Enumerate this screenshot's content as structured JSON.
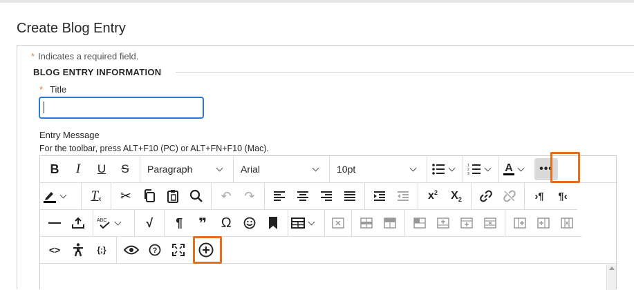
{
  "page": {
    "title": "Create Blog Entry",
    "required_note": "Indicates a required field.",
    "required_marker": "*"
  },
  "section": {
    "title": "BLOG ENTRY INFORMATION"
  },
  "title_field": {
    "label": "Title",
    "value": ""
  },
  "entry_message": {
    "label": "Entry Message",
    "toolbar_hint": "For the toolbar, press ALT+F10 (PC) or ALT+FN+F10 (Mac)."
  },
  "toolbar": {
    "bold": "B",
    "italic": "I",
    "underline": "U",
    "strikethrough": "S",
    "paragraph_format": "Paragraph",
    "font_family": "Arial",
    "font_size": "10pt",
    "text_color": "A",
    "more": "•••",
    "superscript_base": "x",
    "superscript_exp": "2",
    "subscript_base": "X",
    "subscript_exp": "2",
    "ltr": "›¶",
    "rtl": "¶‹",
    "paragraph_mark": "¶",
    "quote": "❞",
    "omega": "Ω",
    "math": "√",
    "code": "<>",
    "variables": "{;}"
  },
  "colors": {
    "accent_orange": "#e46e1b",
    "focus_blue": "#2b77d8",
    "required_orange": "#e67c2a"
  }
}
